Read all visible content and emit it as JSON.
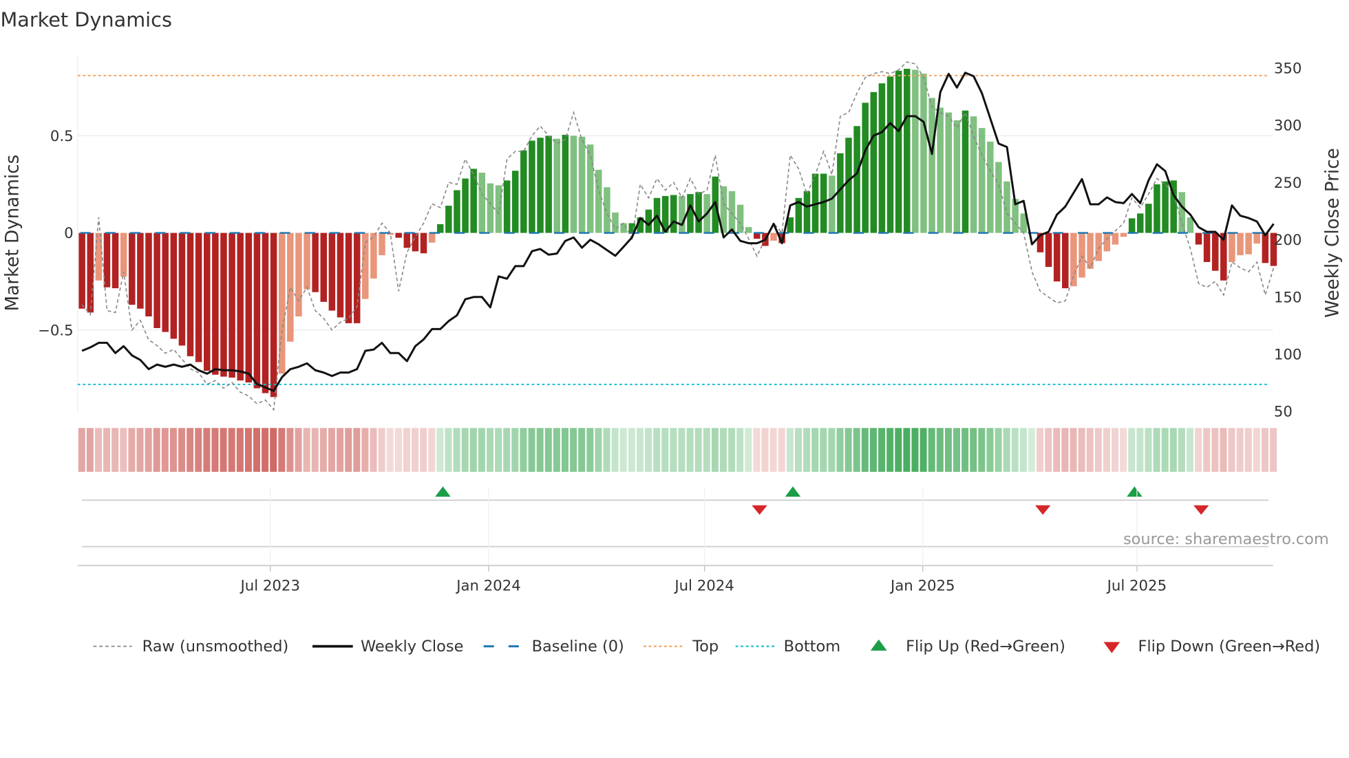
{
  "chart_data": {
    "type": "bar",
    "title": "Market Dynamics",
    "ylabel": "Market Dynamics",
    "y2label": "Weekly Close Price",
    "ylim": [
      -0.92,
      0.92
    ],
    "y2lim": [
      50,
      362
    ],
    "yticks": [
      {
        "v": 0.5,
        "label": "0.5"
      },
      {
        "v": 0,
        "label": "0"
      },
      {
        "v": -0.5,
        "label": "−0.5"
      }
    ],
    "y2ticks": [
      {
        "v": 350,
        "label": "350"
      },
      {
        "v": 300,
        "label": "300"
      },
      {
        "v": 250,
        "label": "250"
      },
      {
        "v": 200,
        "label": "200"
      },
      {
        "v": 150,
        "label": "150"
      },
      {
        "v": 100,
        "label": "100"
      },
      {
        "v": 50,
        "label": "50"
      }
    ],
    "xticks": [
      {
        "week": 22.6,
        "label": "Jul 2023"
      },
      {
        "week": 48.8,
        "label": "Jan 2024"
      },
      {
        "week": 74.7,
        "label": "Jul 2024"
      },
      {
        "week": 100.9,
        "label": "Jan 2025"
      },
      {
        "week": 126.6,
        "label": "Jul 2025"
      }
    ],
    "top_level": 0.81,
    "bottom_level": -0.78,
    "baseline": 0,
    "smoothed": [
      -0.39,
      -0.41,
      -0.245,
      -0.28,
      -0.285,
      -0.225,
      -0.37,
      -0.39,
      -0.43,
      -0.49,
      -0.51,
      -0.545,
      -0.58,
      -0.635,
      -0.665,
      -0.71,
      -0.73,
      -0.74,
      -0.745,
      -0.76,
      -0.77,
      -0.8,
      -0.825,
      -0.845,
      -0.725,
      -0.56,
      -0.43,
      -0.29,
      -0.305,
      -0.355,
      -0.4,
      -0.435,
      -0.465,
      -0.465,
      -0.34,
      -0.235,
      -0.115,
      -0.01,
      -0.025,
      -0.077,
      -0.095,
      -0.105,
      -0.05,
      0.045,
      0.14,
      0.22,
      0.28,
      0.33,
      0.31,
      0.255,
      0.245,
      0.27,
      0.32,
      0.425,
      0.475,
      0.49,
      0.5,
      0.485,
      0.505,
      0.5,
      0.495,
      0.455,
      0.325,
      0.235,
      0.105,
      0.05,
      0.05,
      0.08,
      0.12,
      0.18,
      0.19,
      0.195,
      0.19,
      0.2,
      0.21,
      0.2,
      0.29,
      0.24,
      0.215,
      0.145,
      0.03,
      -0.03,
      -0.067,
      -0.04,
      -0.053,
      0.08,
      0.18,
      0.215,
      0.305,
      0.305,
      0.295,
      0.41,
      0.49,
      0.55,
      0.67,
      0.725,
      0.77,
      0.805,
      0.835,
      0.845,
      0.84,
      0.82,
      0.695,
      0.645,
      0.62,
      0.58,
      0.63,
      0.6,
      0.54,
      0.47,
      0.365,
      0.265,
      0.175,
      0.1,
      0.0,
      -0.1,
      -0.175,
      -0.25,
      -0.285,
      -0.275,
      -0.23,
      -0.185,
      -0.145,
      -0.095,
      -0.06,
      -0.02,
      0.075,
      0.1,
      0.15,
      0.25,
      0.265,
      0.27,
      0.21,
      0.08,
      -0.06,
      -0.15,
      -0.195,
      -0.245,
      -0.15,
      -0.115,
      -0.11,
      -0.055,
      -0.155,
      -0.17
    ],
    "raw": [
      -0.37,
      -0.42,
      0.08,
      -0.4,
      -0.41,
      -0.2,
      -0.5,
      -0.45,
      -0.55,
      -0.58,
      -0.62,
      -0.6,
      -0.65,
      -0.7,
      -0.72,
      -0.78,
      -0.76,
      -0.8,
      -0.77,
      -0.82,
      -0.84,
      -0.88,
      -0.86,
      -0.91,
      -0.5,
      -0.28,
      -0.35,
      -0.28,
      -0.4,
      -0.44,
      -0.5,
      -0.46,
      -0.44,
      -0.38,
      -0.05,
      -0.02,
      0.05,
      0.0,
      -0.3,
      -0.1,
      -0.02,
      0.05,
      0.15,
      0.13,
      0.26,
      0.25,
      0.38,
      0.3,
      0.2,
      0.15,
      0.1,
      0.38,
      0.42,
      0.42,
      0.5,
      0.55,
      0.5,
      0.46,
      0.48,
      0.62,
      0.48,
      0.4,
      0.22,
      0.1,
      0.02,
      0.05,
      -0.03,
      0.25,
      0.18,
      0.28,
      0.22,
      0.26,
      0.18,
      0.28,
      0.2,
      0.22,
      0.4,
      0.15,
      0.1,
      0.05,
      -0.03,
      -0.12,
      -0.03,
      0.05,
      0.0,
      0.4,
      0.33,
      0.2,
      0.3,
      0.42,
      0.3,
      0.6,
      0.62,
      0.72,
      0.8,
      0.82,
      0.83,
      0.82,
      0.84,
      0.88,
      0.87,
      0.8,
      0.65,
      0.62,
      0.6,
      0.54,
      0.62,
      0.5,
      0.4,
      0.32,
      0.25,
      0.1,
      0.05,
      0.0,
      -0.2,
      -0.3,
      -0.33,
      -0.36,
      -0.35,
      -0.22,
      -0.12,
      -0.18,
      -0.08,
      -0.03,
      0.01,
      0.05,
      0.18,
      0.13,
      0.2,
      0.28,
      0.25,
      0.2,
      0.05,
      -0.08,
      -0.26,
      -0.28,
      -0.25,
      -0.32,
      -0.15,
      -0.18,
      -0.2,
      -0.15,
      -0.32,
      -0.18
    ],
    "close": [
      103,
      106,
      110,
      110,
      101,
      107,
      99,
      95,
      87,
      91,
      89,
      91,
      89,
      91,
      86,
      83,
      87,
      86,
      86,
      85,
      83,
      74,
      71,
      68,
      80,
      87,
      89,
      92,
      86,
      84,
      81,
      84,
      84,
      87,
      103,
      104,
      110,
      101,
      101,
      94,
      107,
      113,
      122,
      122,
      129,
      134,
      148,
      150,
      150,
      141,
      168,
      166,
      177,
      177,
      190,
      192,
      187,
      188,
      199,
      202,
      193,
      200,
      196,
      191,
      186,
      194,
      202,
      219,
      213,
      221,
      207,
      216,
      213,
      230,
      216,
      223,
      233,
      202,
      209,
      199,
      197,
      197,
      200,
      214,
      197,
      230,
      233,
      229,
      231,
      233,
      236,
      244,
      252,
      258,
      278,
      291,
      294,
      302,
      295,
      308,
      308,
      303,
      275,
      329,
      345,
      333,
      346,
      343,
      328,
      306,
      284,
      281,
      231,
      234,
      196,
      204,
      207,
      222,
      229,
      241,
      253,
      231,
      231,
      237,
      233,
      232,
      240,
      232,
      252,
      266,
      260,
      239,
      229,
      222,
      211,
      207,
      207,
      200,
      230,
      221,
      219,
      216,
      204,
      214
    ],
    "flips_up": [
      43,
      85,
      126
    ],
    "flips_down": [
      81,
      115,
      134
    ],
    "colors": {
      "dark_red": "#b22222",
      "light_red": "#e9967a",
      "dark_green": "#228b22",
      "light_green": "#80c080",
      "baseline": "#1f77b4",
      "top": "#f4a460",
      "bottom": "#17becf",
      "flip_up": "#1a9e47",
      "flip_down": "#d62728",
      "raw": "#888888",
      "close": "#111111"
    },
    "legend": [
      {
        "label": "Raw (unsmoothed)",
        "style": "raw"
      },
      {
        "label": "Weekly Close",
        "style": "close"
      },
      {
        "label": "Baseline (0)",
        "style": "baseline"
      },
      {
        "label": "Top",
        "style": "top"
      },
      {
        "label": "Bottom",
        "style": "bottom"
      },
      {
        "label": "Flip Up (Red→Green)",
        "style": "flip_up"
      },
      {
        "label": "Flip Down (Green→Red)",
        "style": "flip_down"
      }
    ],
    "legend_position": "bottom",
    "source": "source: sharemaestro.com"
  }
}
